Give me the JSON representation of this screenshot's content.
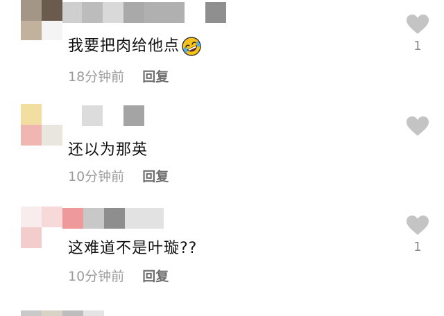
{
  "comments": [
    {
      "text": "我要把肉给他点",
      "time": "18分钟前",
      "reply": "回复",
      "likes": "1",
      "emoji": "rolling-on-floor-laughing"
    },
    {
      "text": "还以为那英",
      "time": "10分钟前",
      "reply": "回复",
      "likes": ""
    },
    {
      "text": "这难道不是叶璇??",
      "time": "10分钟前",
      "reply": "回复",
      "likes": "1"
    }
  ],
  "colors": {
    "heart": "#c4c4c4",
    "text": "#111111",
    "meta": "#9b9b9b"
  }
}
